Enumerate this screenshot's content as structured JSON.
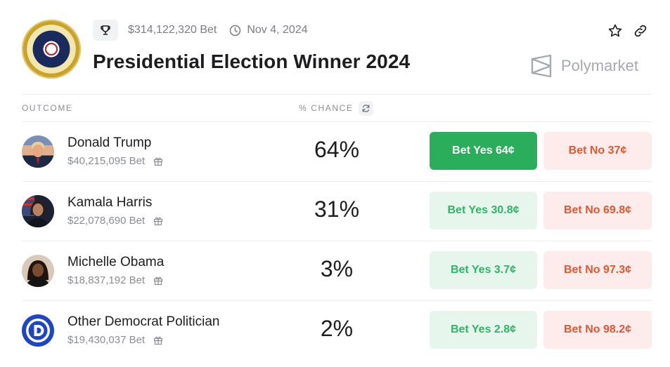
{
  "header": {
    "volume": "$314,122,320 Bet",
    "date": "Nov 4, 2024",
    "title": "Presidential Election Winner 2024",
    "brand": "Polymarket",
    "icons": [
      "trophy-icon",
      "clock-icon",
      "star-icon",
      "link-icon",
      "presidential-seal"
    ]
  },
  "columns": {
    "outcome": "OUTCOME",
    "chance": "% CHANCE"
  },
  "colors": {
    "yes_primary_bg": "#2aae5c",
    "yes_bg": "#e6f6ec",
    "yes_text": "#2fb567",
    "no_bg": "#fdeceb",
    "no_text": "#e0582f"
  },
  "outcomes": [
    {
      "name": "Donald Trump",
      "volume": "$40,215,095 Bet",
      "chance": "64%",
      "yes": "Bet Yes 64¢",
      "no": "Bet No 37¢"
    },
    {
      "name": "Kamala Harris",
      "volume": "$22,078,690 Bet",
      "chance": "31%",
      "yes": "Bet Yes 30.8¢",
      "no": "Bet No 69.8¢"
    },
    {
      "name": "Michelle Obama",
      "volume": "$18,837,192 Bet",
      "chance": "3%",
      "yes": "Bet Yes 3.7¢",
      "no": "Bet No 97.3¢"
    },
    {
      "name": "Other Democrat Politician",
      "volume": "$19,430,037 Bet",
      "chance": "2%",
      "yes": "Bet Yes 2.8¢",
      "no": "Bet No 98.2¢"
    }
  ]
}
